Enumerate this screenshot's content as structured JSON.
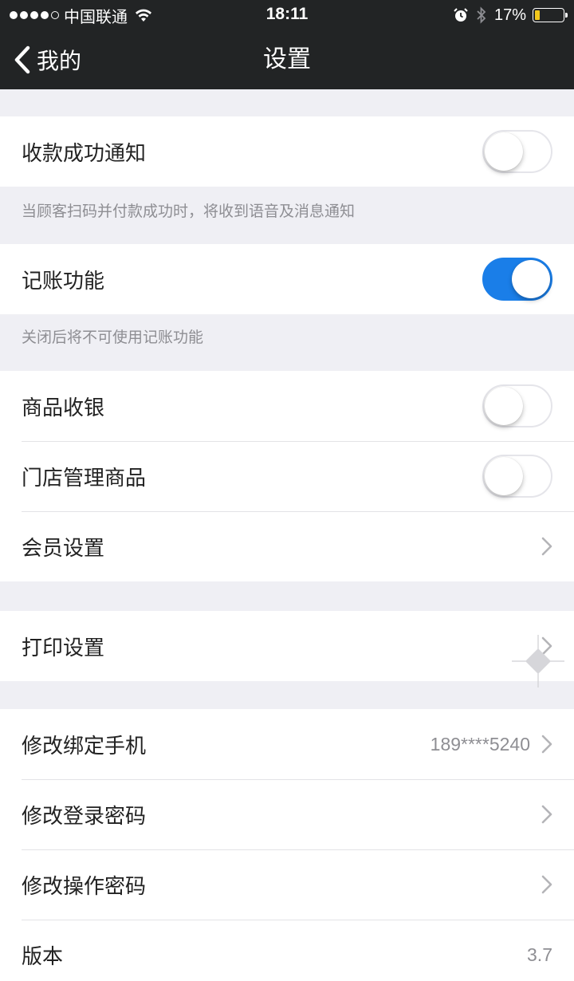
{
  "status_bar": {
    "carrier": "中国联通",
    "time": "18:11",
    "battery_text": "17%",
    "battery_level": 0.17,
    "signal_bars": 4,
    "signal_total": 5,
    "icons": [
      "wifi-icon",
      "alarm-icon",
      "bluetooth-icon",
      "battery-icon"
    ]
  },
  "nav": {
    "back_label": "我的",
    "title": "设置"
  },
  "sections": {
    "notify": {
      "label": "收款成功通知",
      "enabled": false,
      "footnote": "当顾客扫码并付款成功时，将收到语音及消息通知"
    },
    "bookkeeping": {
      "label": "记账功能",
      "enabled": true,
      "footnote": "关闭后将不可使用记账功能"
    },
    "goods": {
      "items": [
        {
          "label": "商品收银",
          "type": "switch",
          "enabled": false
        },
        {
          "label": "门店管理商品",
          "type": "switch",
          "enabled": false
        },
        {
          "label": "会员设置",
          "type": "link"
        }
      ]
    },
    "print": {
      "label": "打印设置"
    },
    "account": {
      "items": [
        {
          "label": "修改绑定手机",
          "value": "189****5240"
        },
        {
          "label": "修改登录密码"
        },
        {
          "label": "修改操作密码"
        },
        {
          "label": "版本",
          "value": "3.7"
        }
      ]
    }
  },
  "colors": {
    "bar_background": "#222425",
    "switch_on": "#1a7ee8",
    "page_background": "#efeff4",
    "battery_fill": "#f2c81b"
  }
}
